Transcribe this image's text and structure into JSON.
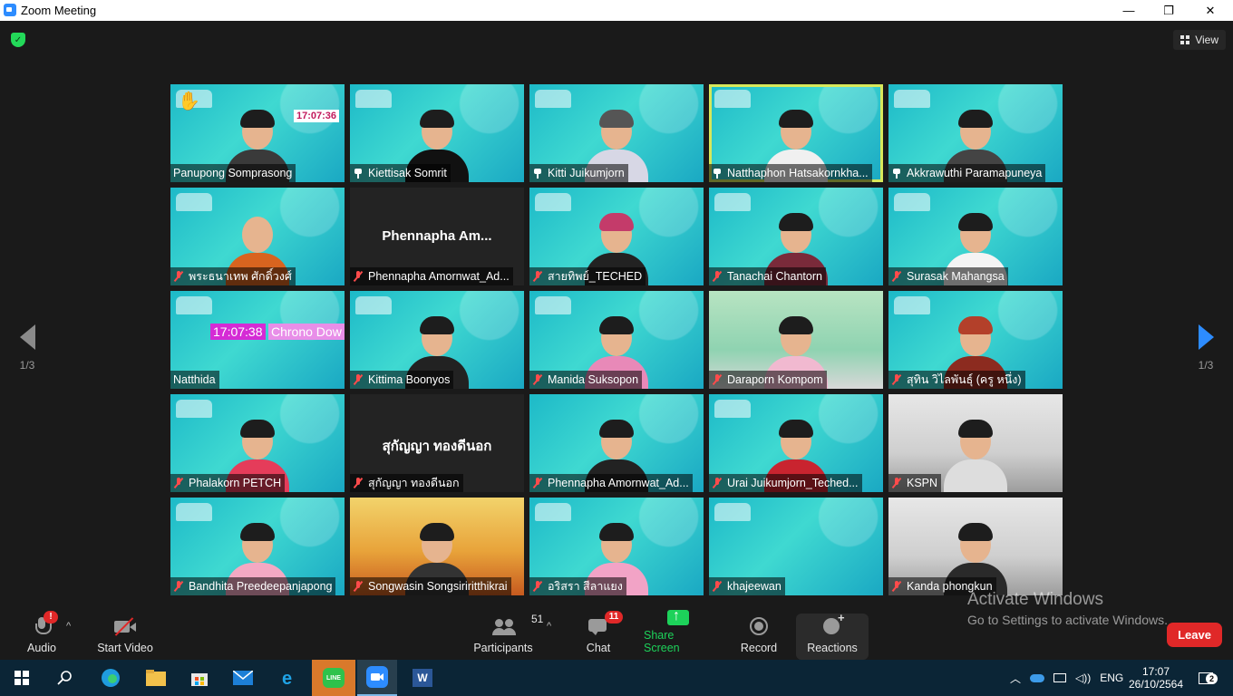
{
  "window": {
    "title": "Zoom Meeting",
    "minimize_glyph": "—",
    "maximize_glyph": "❐",
    "close_glyph": "✕"
  },
  "header": {
    "view_label": "View",
    "security_icon": "shield-check-icon"
  },
  "pager": {
    "prev_label": "1/3",
    "next_label": "1/3"
  },
  "clocks": {
    "tile1": "17:07:36",
    "tile11_time": "17:07:38",
    "tile11_text": "Chrono Dow"
  },
  "participants": [
    {
      "name": "Panupong Somprasong",
      "mic": "none"
    },
    {
      "name": "Kiettisak Somrit",
      "mic": "pin"
    },
    {
      "name": "Kitti Juikumjorn",
      "mic": "pin"
    },
    {
      "name": "Natthaphon Hatsakornkha...",
      "mic": "pin"
    },
    {
      "name": "Akkrawuthi Paramapuneya",
      "mic": "pin"
    },
    {
      "name": "พระธนาเทพ ศักดิ์วงศ์",
      "mic": "muted"
    },
    {
      "name": "Phennapha Amornwat_Ad...",
      "mic": "muted",
      "center": "Phennapha  Am..."
    },
    {
      "name": "สายทิพย์_TECHED",
      "mic": "muted"
    },
    {
      "name": "Tanachai Chantorn",
      "mic": "muted"
    },
    {
      "name": "Surasak Mahangsa",
      "mic": "muted"
    },
    {
      "name": "Natthida",
      "mic": "none"
    },
    {
      "name": "Kittima Boonyos",
      "mic": "muted"
    },
    {
      "name": "Manida Suksopon",
      "mic": "muted"
    },
    {
      "name": "Daraporn Kompom",
      "mic": "muted"
    },
    {
      "name": "สุทิน วิไลพันธุ์ (ครู หนึ่ง)",
      "mic": "muted"
    },
    {
      "name": "Phalakorn PETCH",
      "mic": "muted"
    },
    {
      "name": "สุกัญญา ทองดีนอก",
      "mic": "muted",
      "center": "สุกัญญา ทองดีนอก"
    },
    {
      "name": "Phennapha Amornwat_Ad...",
      "mic": "muted"
    },
    {
      "name": "Urai Juikumjorn_Teched...",
      "mic": "muted"
    },
    {
      "name": "KSPN",
      "mic": "muted"
    },
    {
      "name": "Bandhita Preedeepanjapong",
      "mic": "muted"
    },
    {
      "name": "Songwasin Songsiriritthikrai",
      "mic": "muted"
    },
    {
      "name": "อริสรา สีลาแยง",
      "mic": "muted"
    },
    {
      "name": "khajeewan",
      "mic": "muted"
    },
    {
      "name": "Kanda phongkun",
      "mic": "muted"
    }
  ],
  "toolbar": {
    "audio_label": "Audio",
    "audio_badge": "!",
    "start_video_label": "Start Video",
    "participants_label": "Participants",
    "participants_count": "51",
    "chat_label": "Chat",
    "chat_badge": "11",
    "share_label": "Share Screen",
    "record_label": "Record",
    "reactions_label": "Reactions",
    "leave_label": "Leave",
    "caret": "^"
  },
  "watermark": {
    "line1": "Activate Windows",
    "line2": "Go to Settings to activate Windows."
  },
  "taskbar": {
    "language": "ENG",
    "time": "17:07",
    "date": "26/10/2564",
    "notifications": "2",
    "line_label": "LINE",
    "word_label": "W"
  },
  "colors": {
    "accent": "#2d8cff",
    "share": "#1dd25a",
    "leave": "#e02828",
    "active_speaker": "#d8e85a"
  }
}
